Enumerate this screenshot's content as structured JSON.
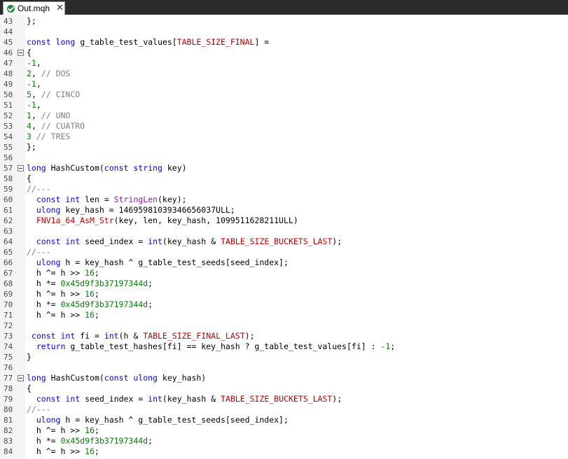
{
  "tab": {
    "title": "Out.mqh",
    "close_glyph": "✕",
    "status_icon": "check-circle-icon"
  },
  "colors": {
    "keyword": "#0000ff",
    "macro": "#c00000",
    "function": "#8a1fa8",
    "number": "#008000",
    "comment": "#808080",
    "text": "#000000",
    "tabbar_bg": "#2b2b2b"
  },
  "lines": [
    {
      "n": "43",
      "fold": false,
      "tokens": [
        [
          "op",
          "};"
        ]
      ]
    },
    {
      "n": "44",
      "fold": false,
      "tokens": []
    },
    {
      "n": "45",
      "fold": false,
      "tokens": [
        [
          "kw",
          "const"
        ],
        [
          "txt",
          " "
        ],
        [
          "kw",
          "long"
        ],
        [
          "txt",
          " g_table_test_values["
        ],
        [
          "mac",
          "TABLE_SIZE_FINAL"
        ],
        [
          "txt",
          "] ="
        ]
      ]
    },
    {
      "n": "46",
      "fold": true,
      "tokens": [
        [
          "op",
          "{"
        ]
      ]
    },
    {
      "n": "47",
      "fold": false,
      "tokens": [
        [
          "num",
          "-1"
        ],
        [
          "op",
          ","
        ]
      ]
    },
    {
      "n": "48",
      "fold": false,
      "tokens": [
        [
          "num",
          "2"
        ],
        [
          "op",
          ", "
        ],
        [
          "cm",
          "// DOS"
        ]
      ]
    },
    {
      "n": "49",
      "fold": false,
      "tokens": [
        [
          "num",
          "-1"
        ],
        [
          "op",
          ","
        ]
      ]
    },
    {
      "n": "50",
      "fold": false,
      "tokens": [
        [
          "num",
          "5"
        ],
        [
          "op",
          ", "
        ],
        [
          "cm",
          "// CINCO"
        ]
      ]
    },
    {
      "n": "51",
      "fold": false,
      "tokens": [
        [
          "num",
          "-1"
        ],
        [
          "op",
          ","
        ]
      ]
    },
    {
      "n": "52",
      "fold": false,
      "tokens": [
        [
          "num",
          "1"
        ],
        [
          "op",
          ", "
        ],
        [
          "cm",
          "// UNO"
        ]
      ]
    },
    {
      "n": "53",
      "fold": false,
      "tokens": [
        [
          "num",
          "4"
        ],
        [
          "op",
          ", "
        ],
        [
          "cm",
          "// CUATRO"
        ]
      ]
    },
    {
      "n": "54",
      "fold": false,
      "tokens": [
        [
          "num",
          "3"
        ],
        [
          "op",
          " "
        ],
        [
          "cm",
          "// TRES"
        ]
      ]
    },
    {
      "n": "55",
      "fold": false,
      "tokens": [
        [
          "op",
          "};"
        ]
      ]
    },
    {
      "n": "56",
      "fold": false,
      "tokens": []
    },
    {
      "n": "57",
      "fold": true,
      "tokens": [
        [
          "kw",
          "long"
        ],
        [
          "txt",
          " HashCustom("
        ],
        [
          "kw",
          "const"
        ],
        [
          "txt",
          " "
        ],
        [
          "kw",
          "string"
        ],
        [
          "txt",
          " key)"
        ]
      ]
    },
    {
      "n": "58",
      "fold": false,
      "tokens": [
        [
          "op",
          "{"
        ]
      ]
    },
    {
      "n": "59",
      "fold": false,
      "tokens": [
        [
          "cm",
          "//---"
        ]
      ]
    },
    {
      "n": "60",
      "fold": false,
      "tokens": [
        [
          "txt",
          "  "
        ],
        [
          "kw",
          "const"
        ],
        [
          "txt",
          " "
        ],
        [
          "kw",
          "int"
        ],
        [
          "txt",
          " len = "
        ],
        [
          "fn",
          "StringLen"
        ],
        [
          "txt",
          "(key);"
        ]
      ]
    },
    {
      "n": "61",
      "fold": false,
      "tokens": [
        [
          "txt",
          "  "
        ],
        [
          "kw",
          "ulong"
        ],
        [
          "txt",
          " key_hash = 14695981039346656037ULL;"
        ]
      ]
    },
    {
      "n": "62",
      "fold": false,
      "tokens": [
        [
          "txt",
          "  "
        ],
        [
          "mac",
          "FNV1a_64_AsM_Str"
        ],
        [
          "txt",
          "(key, len, key_hash, 1099511628211ULL)"
        ]
      ]
    },
    {
      "n": "63",
      "fold": false,
      "tokens": []
    },
    {
      "n": "64",
      "fold": false,
      "tokens": [
        [
          "txt",
          "  "
        ],
        [
          "kw",
          "const"
        ],
        [
          "txt",
          " "
        ],
        [
          "kw",
          "int"
        ],
        [
          "txt",
          " seed_index = "
        ],
        [
          "kw",
          "int"
        ],
        [
          "txt",
          "(key_hash & "
        ],
        [
          "mac",
          "TABLE_SIZE_BUCKETS_LAST"
        ],
        [
          "txt",
          ");"
        ]
      ]
    },
    {
      "n": "65",
      "fold": false,
      "tokens": [
        [
          "cm",
          "//---"
        ]
      ]
    },
    {
      "n": "66",
      "fold": false,
      "tokens": [
        [
          "txt",
          "  "
        ],
        [
          "kw",
          "ulong"
        ],
        [
          "txt",
          " h = key_hash ^ g_table_test_seeds[seed_index];"
        ]
      ]
    },
    {
      "n": "67",
      "fold": false,
      "tokens": [
        [
          "txt",
          "  h ^= h >> "
        ],
        [
          "num",
          "16"
        ],
        [
          "txt",
          ";"
        ]
      ]
    },
    {
      "n": "68",
      "fold": false,
      "tokens": [
        [
          "txt",
          "  h *= "
        ],
        [
          "num",
          "0x45d9f3b37197344d"
        ],
        [
          "txt",
          ";"
        ]
      ]
    },
    {
      "n": "69",
      "fold": false,
      "tokens": [
        [
          "txt",
          "  h ^= h >> "
        ],
        [
          "num",
          "16"
        ],
        [
          "txt",
          ";"
        ]
      ]
    },
    {
      "n": "70",
      "fold": false,
      "tokens": [
        [
          "txt",
          "  h *= "
        ],
        [
          "num",
          "0x45d9f3b37197344d"
        ],
        [
          "txt",
          ";"
        ]
      ]
    },
    {
      "n": "71",
      "fold": false,
      "tokens": [
        [
          "txt",
          "  h ^= h >> "
        ],
        [
          "num",
          "16"
        ],
        [
          "txt",
          ";"
        ]
      ]
    },
    {
      "n": "72",
      "fold": false,
      "tokens": []
    },
    {
      "n": "73",
      "fold": false,
      "tokens": [
        [
          "txt",
          " "
        ],
        [
          "kw",
          "const"
        ],
        [
          "txt",
          " "
        ],
        [
          "kw",
          "int"
        ],
        [
          "txt",
          " fi = "
        ],
        [
          "kw",
          "int"
        ],
        [
          "txt",
          "(h & "
        ],
        [
          "mac",
          "TABLE_SIZE_FINAL_LAST"
        ],
        [
          "txt",
          ");"
        ]
      ]
    },
    {
      "n": "74",
      "fold": false,
      "tokens": [
        [
          "txt",
          "  "
        ],
        [
          "kw",
          "return"
        ],
        [
          "txt",
          " g_table_test_hashes[fi] == key_hash ? g_table_test_values[fi] : "
        ],
        [
          "num",
          "-1"
        ],
        [
          "txt",
          ";"
        ]
      ]
    },
    {
      "n": "75",
      "fold": false,
      "tokens": [
        [
          "op",
          "}"
        ]
      ]
    },
    {
      "n": "76",
      "fold": false,
      "tokens": []
    },
    {
      "n": "77",
      "fold": true,
      "tokens": [
        [
          "kw",
          "long"
        ],
        [
          "txt",
          " HashCustom("
        ],
        [
          "kw",
          "const"
        ],
        [
          "txt",
          " "
        ],
        [
          "kw",
          "ulong"
        ],
        [
          "txt",
          " key_hash)"
        ]
      ]
    },
    {
      "n": "78",
      "fold": false,
      "tokens": [
        [
          "op",
          "{"
        ]
      ]
    },
    {
      "n": "79",
      "fold": false,
      "tokens": [
        [
          "txt",
          "  "
        ],
        [
          "kw",
          "const"
        ],
        [
          "txt",
          " "
        ],
        [
          "kw",
          "int"
        ],
        [
          "txt",
          " seed_index = "
        ],
        [
          "kw",
          "int"
        ],
        [
          "txt",
          "(key_hash & "
        ],
        [
          "mac",
          "TABLE_SIZE_BUCKETS_LAST"
        ],
        [
          "txt",
          ");"
        ]
      ]
    },
    {
      "n": "80",
      "fold": false,
      "tokens": [
        [
          "cm",
          "//---"
        ]
      ]
    },
    {
      "n": "81",
      "fold": false,
      "tokens": [
        [
          "txt",
          "  "
        ],
        [
          "kw",
          "ulong"
        ],
        [
          "txt",
          " h = key_hash ^ g_table_test_seeds[seed_index];"
        ]
      ]
    },
    {
      "n": "82",
      "fold": false,
      "tokens": [
        [
          "txt",
          "  h ^= h >> "
        ],
        [
          "num",
          "16"
        ],
        [
          "txt",
          ";"
        ]
      ]
    },
    {
      "n": "83",
      "fold": false,
      "tokens": [
        [
          "txt",
          "  h *= "
        ],
        [
          "num",
          "0x45d9f3b37197344d"
        ],
        [
          "txt",
          ";"
        ]
      ]
    },
    {
      "n": "84",
      "fold": false,
      "tokens": [
        [
          "txt",
          "  h ^= h >> "
        ],
        [
          "num",
          "16"
        ],
        [
          "txt",
          ";"
        ]
      ]
    }
  ]
}
